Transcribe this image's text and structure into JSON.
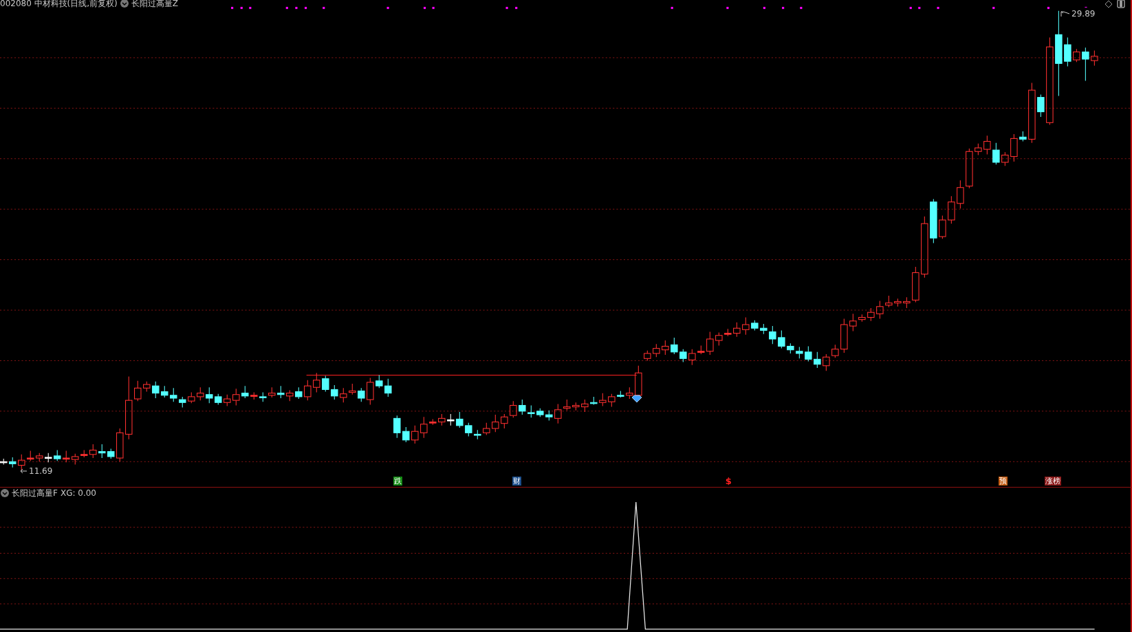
{
  "header": {
    "title": "002080 中材科技(日线,前复权)",
    "indicator": "长阳过高量Z"
  },
  "price_labels": {
    "high": "29.89",
    "low": "11.69"
  },
  "event_markers": [
    {
      "label": "跌",
      "kind": "badge",
      "color": "#138a13"
    },
    {
      "label": "财",
      "kind": "badge",
      "color": "#1d4f8c"
    },
    {
      "label": "$",
      "kind": "text",
      "color": "#ff2020"
    },
    {
      "label": "预",
      "kind": "badge",
      "color": "#c45a10"
    },
    {
      "label": "涨榜",
      "kind": "badge",
      "color": "#8c1818"
    }
  ],
  "sub_panel": {
    "indicator": "长阳过高量F",
    "reading": "XG: 0.00"
  }
}
